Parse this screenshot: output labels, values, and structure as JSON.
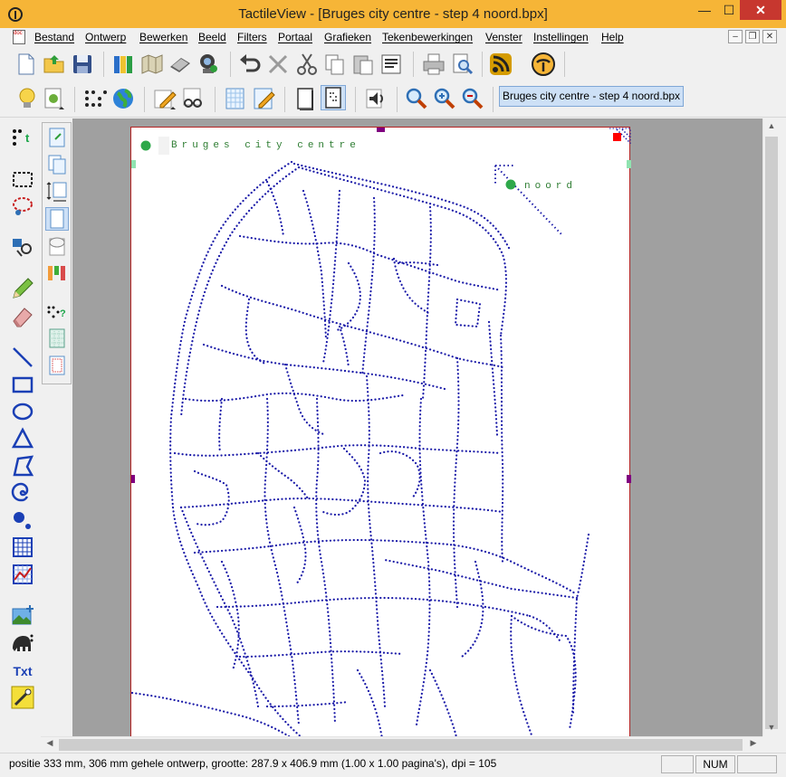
{
  "window": {
    "title": "TactileView - [Bruges city centre - step 4 noord.bpx]",
    "controls": {
      "minimize": "—",
      "maximize": "☐",
      "close": "✕"
    }
  },
  "menu": {
    "items": [
      "Bestand",
      "Ontwerp",
      "Bewerken",
      "Beeld",
      "Filters",
      "Portaal",
      "Grafieken",
      "Tekenbewerkingen",
      "Venster",
      "Instellingen",
      "Help"
    ],
    "mdi_controls": {
      "minimize": "–",
      "restore": "❐",
      "close": "✕"
    }
  },
  "document_tab": {
    "label": "Bruges city centre - step 4 noord.bpx"
  },
  "map": {
    "title_braille": "Bruges city centre",
    "north_label": "noord"
  },
  "tools": {
    "text_tool_label": "Txt"
  },
  "scrollbars": {
    "up": "▲",
    "down": "▼",
    "left": "◀",
    "right": "▶"
  },
  "status": {
    "text": "positie 333 mm, 306 mm gehele ontwerp, grootte: 287.9 x 406.9 mm (1.00 x 1.00 pagina's), dpi = 105",
    "num": "NUM"
  },
  "colors": {
    "title_bar": "#f6b537",
    "route_dots": "#1a1aa8",
    "braille_text": "#2e7d32",
    "page_border": "#b22222",
    "handle": "#800080",
    "close_button": "#c7372f"
  }
}
